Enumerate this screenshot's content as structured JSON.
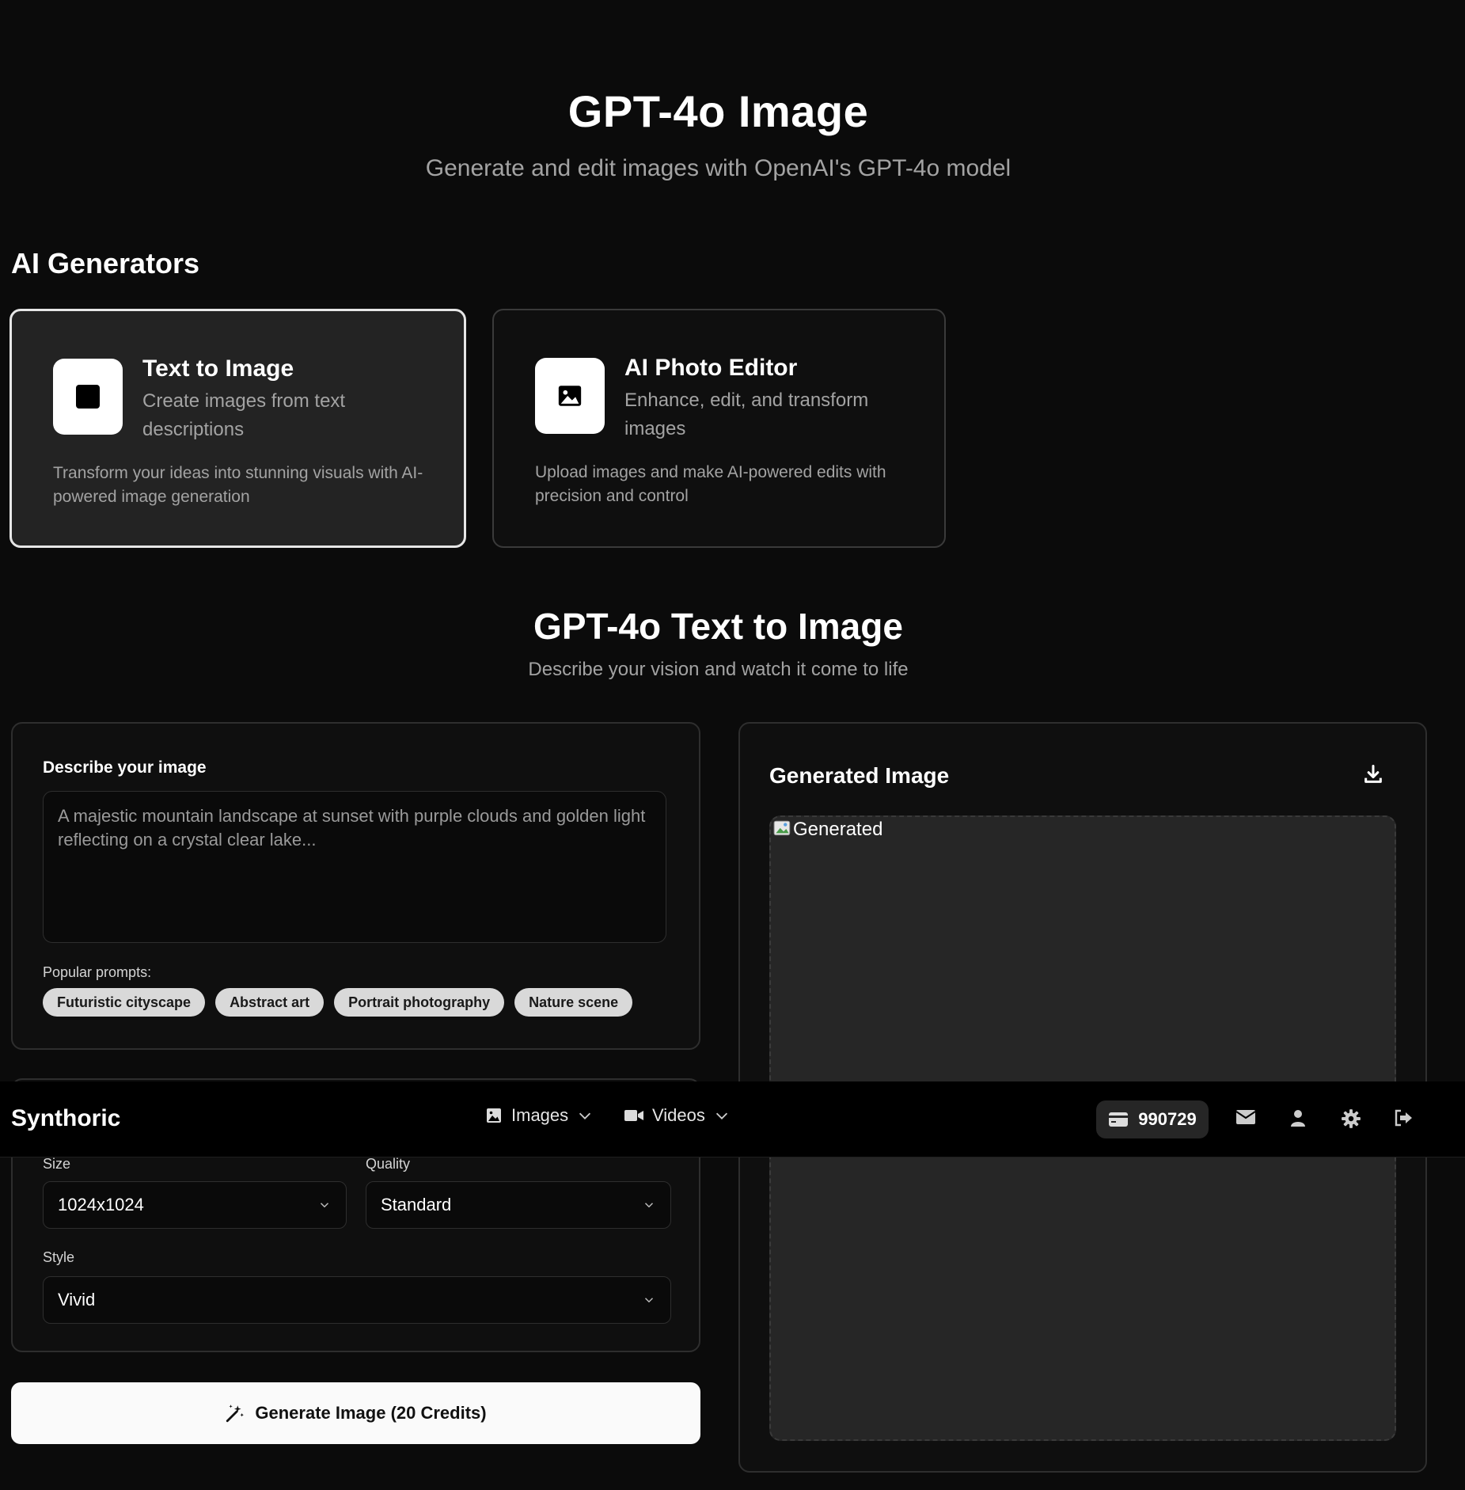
{
  "hero": {
    "title": "GPT-4o Image",
    "subtitle": "Generate and edit images with OpenAI's GPT-4o model"
  },
  "generators": {
    "section_title": "AI Generators",
    "cards": [
      {
        "title": "Text to Image",
        "subtitle": "Create images from text descriptions",
        "description": "Transform your ideas into stunning visuals with AI-powered image generation",
        "icon": "square-icon",
        "active": true
      },
      {
        "title": "AI Photo Editor",
        "subtitle": "Enhance, edit, and transform images",
        "description": "Upload images and make AI-powered edits with precision and control",
        "icon": "image-icon",
        "active": false
      }
    ]
  },
  "text_to_image": {
    "title": "GPT-4o Text to Image",
    "subtitle": "Describe your vision and watch it come to life"
  },
  "prompt": {
    "label": "Describe your image",
    "placeholder": "A majestic mountain landscape at sunset with purple clouds and golden light reflecting on a crystal clear lake...",
    "value": "",
    "popular_label": "Popular prompts:",
    "popular": [
      "Futuristic cityscape",
      "Abstract art",
      "Portrait photography",
      "Nature scene"
    ]
  },
  "settings": {
    "size_label": "Size",
    "size_value": "1024x1024",
    "quality_label": "Quality",
    "quality_value": "Standard",
    "style_label": "Style",
    "style_value": "Vivid"
  },
  "generate_button": "Generate Image (20 Credits)",
  "output": {
    "title": "Generated Image",
    "image_alt": "Generated"
  },
  "navbar": {
    "brand": "Synthoric",
    "menu": [
      {
        "label": "Images",
        "icon": "image-icon"
      },
      {
        "label": "Videos",
        "icon": "video-camera-icon"
      }
    ],
    "credits": "990729",
    "icons": [
      "mail-icon",
      "user-icon",
      "gear-icon",
      "logout-icon"
    ]
  },
  "colors": {
    "background": "#0b0b0b",
    "card_active": "#232323",
    "muted_text": "#a3a3a3",
    "chip": "#d9d9d9",
    "primary_button": "#fafafa"
  }
}
